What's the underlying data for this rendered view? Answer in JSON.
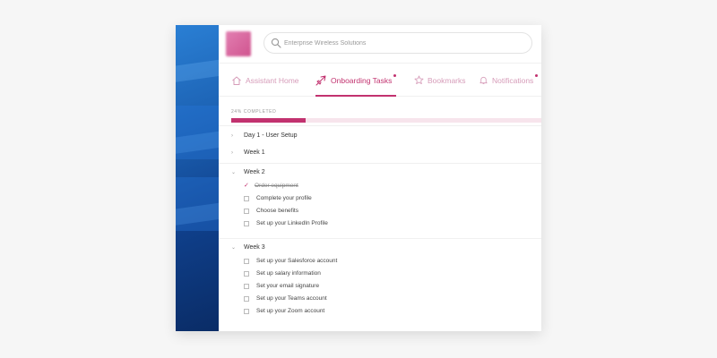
{
  "search": {
    "placeholder": "Enterprise Wireless Solutions"
  },
  "tabs": [
    {
      "label": "Assistant Home",
      "icon": "home-icon",
      "active": false,
      "badge": false
    },
    {
      "label": "Onboarding Tasks",
      "icon": "rocket-icon",
      "active": true,
      "badge": true
    },
    {
      "label": "Bookmarks",
      "icon": "star-icon",
      "active": false,
      "badge": false
    },
    {
      "label": "Notifications",
      "icon": "bell-icon",
      "active": false,
      "badge": true
    }
  ],
  "progress": {
    "label": "24% COMPLETED",
    "value": 0.24
  },
  "sections": [
    {
      "title": "Day 1 - User Setup",
      "expanded": false,
      "tasks": []
    },
    {
      "title": "Week 1",
      "expanded": false,
      "tasks": []
    },
    {
      "title": "Week 2",
      "expanded": true,
      "tasks": [
        {
          "label": "Order equipment",
          "done": true
        },
        {
          "label": "Complete your profile",
          "done": false
        },
        {
          "label": "Choose benefits",
          "done": false
        },
        {
          "label": "Set up your LinkedIn Profile",
          "done": false
        }
      ]
    },
    {
      "title": "Week 3",
      "expanded": true,
      "tasks": [
        {
          "label": "Set up your Salesforce account",
          "done": false
        },
        {
          "label": "Set up salary information",
          "done": false
        },
        {
          "label": "Set your email signature",
          "done": false
        },
        {
          "label": "Set up your Teams account",
          "done": false
        },
        {
          "label": "Set up your Zoom account",
          "done": false
        }
      ]
    }
  ],
  "colors": {
    "accent": "#c2326f",
    "accent_light": "#f7e4ec",
    "tab_inactive": "#d69cb9"
  }
}
